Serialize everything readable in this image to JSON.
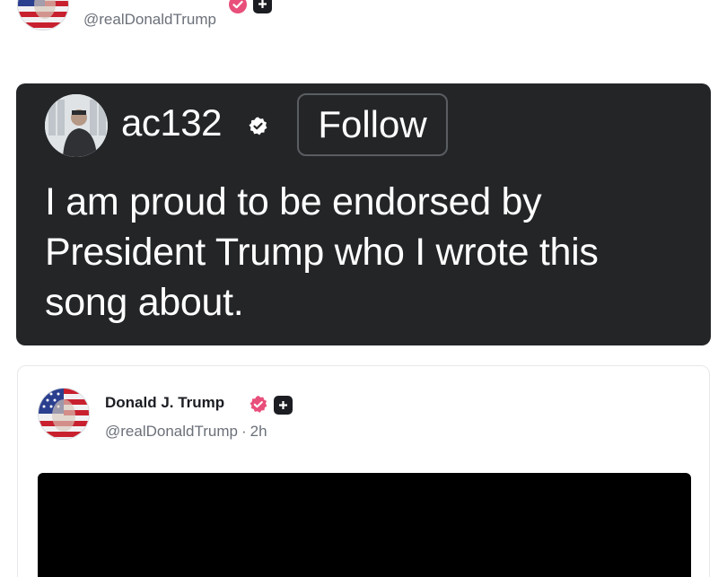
{
  "top_post": {
    "handle": "@realDonaldTrump"
  },
  "embedded_card": {
    "username": "ac132",
    "follow_label": "Follow",
    "text": "I am proud to be endorsed by President Trump who I wrote this song about."
  },
  "post": {
    "display_name": "Donald J. Trump",
    "handle": "@realDonaldTrump",
    "separator": "·",
    "time_ago": "2h"
  },
  "colors": {
    "verified_pink": "#e84f7a",
    "card_dark": "#232527",
    "muted_text": "#6b7079"
  },
  "icons": {
    "verified": "verified-badge-icon",
    "plus_square": "plus-square-icon"
  }
}
